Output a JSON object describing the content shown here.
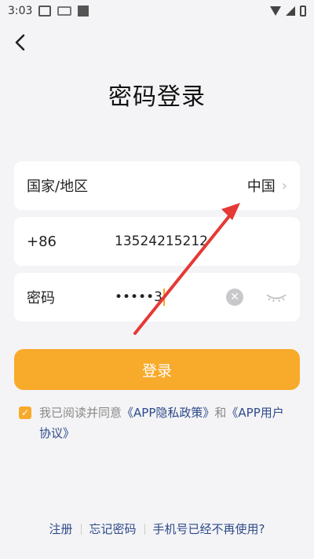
{
  "status_bar": {
    "time": "3:03"
  },
  "title": "密码登录",
  "region": {
    "label": "国家/地区",
    "value": "中国"
  },
  "phone": {
    "code": "+86",
    "value": "13524215212"
  },
  "password": {
    "label": "密码",
    "value": "•••••3"
  },
  "login_button": "登录",
  "agreement": {
    "prefix": "我已阅读并同意",
    "privacy_link": "《APP隐私政策》",
    "and": "和",
    "user_link": "《APP用户协议》"
  },
  "footer": {
    "register": "注册",
    "forgot": "忘记密码",
    "phone_unused": "手机号已经不再使用?"
  },
  "colors": {
    "accent": "#f8aa2b",
    "link": "#2e4a8a",
    "annotation": "#e53935"
  }
}
